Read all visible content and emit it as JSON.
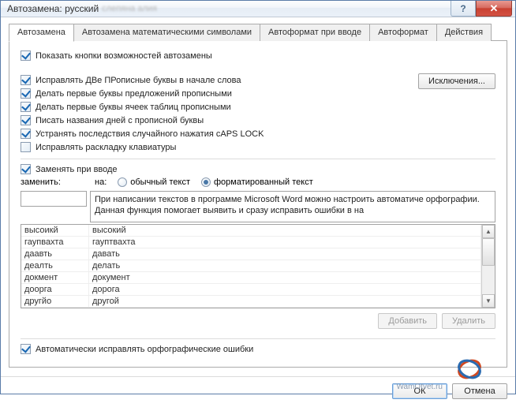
{
  "window": {
    "title": "Автозамена: русский",
    "help_tooltip": "?",
    "close_tooltip": "✕"
  },
  "tabs": [
    {
      "label": "Автозамена",
      "active": true
    },
    {
      "label": "Автозамена математическими символами",
      "active": false
    },
    {
      "label": "Автоформат при вводе",
      "active": false
    },
    {
      "label": "Автоформат",
      "active": false
    },
    {
      "label": "Действия",
      "active": false
    }
  ],
  "top_check": {
    "label": "Показать кнопки возможностей автозамены",
    "checked": true
  },
  "checks": [
    {
      "label": "Исправлять ДВе ПРописные буквы в начале слова",
      "checked": true
    },
    {
      "label": "Делать первые буквы предложений прописными",
      "checked": true
    },
    {
      "label": "Делать первые буквы ячеек таблиц прописными",
      "checked": true
    },
    {
      "label": "Писать названия дней с прописной буквы",
      "checked": true
    },
    {
      "label": "Устранять последствия случайного нажатия cAPS LOCK",
      "checked": true
    },
    {
      "label": "Исправлять раскладку клавиатуры",
      "checked": false
    }
  ],
  "exceptions_btn": "Исключения...",
  "replace_on_input": {
    "label": "Заменять при вводе",
    "checked": true
  },
  "replace_row": {
    "replace_label": "заменить:",
    "with_label": "на:",
    "radio_plain": "обычный текст",
    "radio_formatted": "форматированный текст",
    "radio_sel": "formatted"
  },
  "input_value": "",
  "preview_text": "При написании текстов в программе Microsoft Word можно настроить автоматиче орфографии. Данная функция помогает выявить и сразу исправить ошибки в на",
  "table": [
    {
      "wrong": "высоикй",
      "right": "высокий"
    },
    {
      "wrong": "гаупвахта",
      "right": "гауптвахта"
    },
    {
      "wrong": "даавть",
      "right": "давать"
    },
    {
      "wrong": "деалть",
      "right": "делать"
    },
    {
      "wrong": "докмент",
      "right": "документ"
    },
    {
      "wrong": "доорга",
      "right": "дорога"
    },
    {
      "wrong": "другйо",
      "right": "другой"
    }
  ],
  "add_btn": "Добавить",
  "delete_btn": "Удалить",
  "auto_spell": {
    "label": "Автоматически исправлять орфографические ошибки",
    "checked": true
  },
  "footer": {
    "ok": "ОК",
    "cancel": "Отмена"
  },
  "watermark": "WamOtvet.ru"
}
